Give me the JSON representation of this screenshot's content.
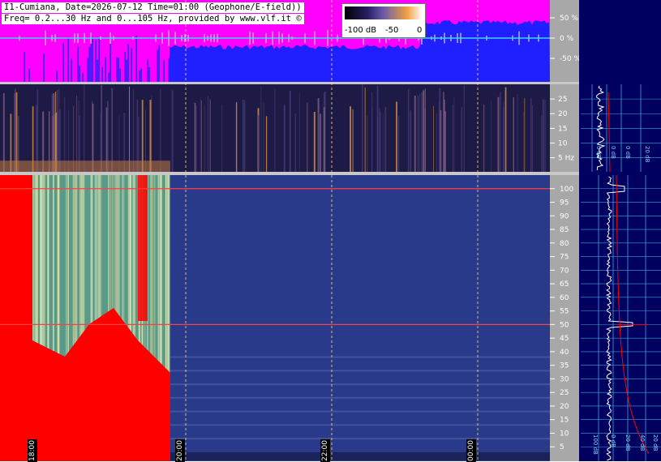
{
  "header": {
    "line1": "I1-Cumiana, Date=2026-07-12 Time=01:00 (Geophone/E-field))",
    "line2": "Freq= 0.2...30 Hz and 0...105 Hz, provided by www.vlf.it ©"
  },
  "colorbar": {
    "ticks": [
      "-100 dB",
      "-50",
      "0"
    ]
  },
  "colors": {
    "magenta": "#ff00ff",
    "blue": "#1f1fff",
    "navy": "#000060",
    "axis_gray": "#a8a8a8",
    "cyan": "#3aa7d8",
    "red": "#ff0000"
  },
  "chart_data": [
    {
      "type": "area",
      "panel": "top amplitude strip",
      "yticks": [
        "50 %",
        "0 %",
        "-50 %"
      ],
      "ytick_values": [
        50,
        0,
        -50
      ],
      "ylim": [
        -100,
        100
      ]
    },
    {
      "type": "heatmap",
      "panel": "0.2-30 Hz spectrogram",
      "yticks": [
        "5 Hz",
        "10",
        "15",
        "20",
        "25"
      ],
      "ytick_values": [
        5,
        10,
        15,
        20,
        25
      ],
      "ylim": [
        0.2,
        30
      ]
    },
    {
      "type": "heatmap",
      "panel": "0-105 Hz spectrogram",
      "yticks": [
        "5",
        "10",
        "15",
        "20",
        "25",
        "30",
        "35",
        "40",
        "45",
        "50",
        "55",
        "60",
        "65",
        "70",
        "75",
        "80",
        "85",
        "90",
        "95",
        "100"
      ],
      "ytick_values": [
        5,
        10,
        15,
        20,
        25,
        30,
        35,
        40,
        45,
        50,
        55,
        60,
        65,
        70,
        75,
        80,
        85,
        90,
        95,
        100
      ],
      "ylim": [
        0,
        105
      ],
      "x_hour_labels": [
        "18:00",
        "20:00",
        "22:00",
        "00:00"
      ],
      "notable_line_hz": [
        50,
        100
      ]
    },
    {
      "type": "line",
      "panel": "upper side spectrum",
      "xticks": [
        "0 dB",
        "0 dB",
        "0 dB",
        "20 dB"
      ]
    },
    {
      "type": "line",
      "panel": "lower side spectrum",
      "xticks": [
        "100 dB",
        "0 dB",
        "20 dB",
        "40 dB",
        "20 dB"
      ]
    }
  ]
}
